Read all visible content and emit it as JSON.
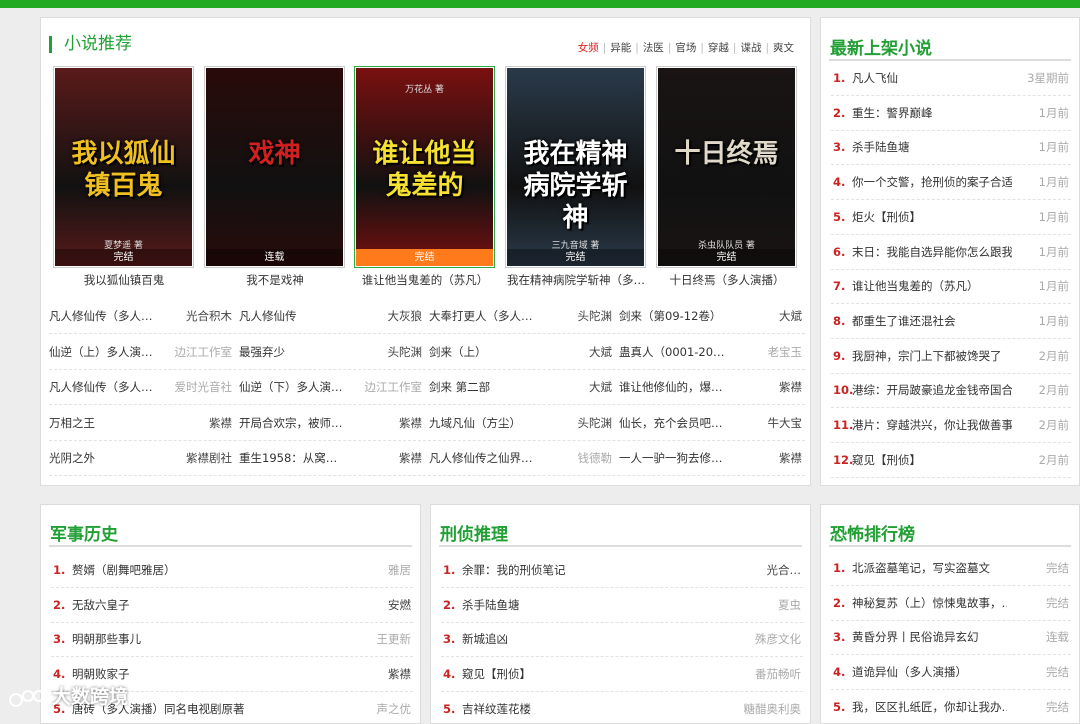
{
  "recommend": {
    "title": "小说推荐",
    "tags": [
      "女频",
      "异能",
      "法医",
      "官场",
      "穿越",
      "谍战",
      "爽文"
    ],
    "active_tag": "女频",
    "covers": [
      {
        "caption": "我以狐仙镇百鬼",
        "cover_text": "我以狐仙镇百鬼",
        "author_line": "夏梦遥 著",
        "status": "完结",
        "bg": "#5a1a1a",
        "accent": "#f0c020"
      },
      {
        "caption": "我不是戏神",
        "cover_text": "戏神",
        "author_line": "",
        "status": "连载",
        "bg": "#2a0a0a",
        "accent": "#d22020"
      },
      {
        "caption": "谁让他当鬼差的（苏凡）",
        "cover_text": "谁让他当鬼差的",
        "author_line": "万花丛 著",
        "status": "完结",
        "bg": "#7a1010",
        "accent": "#f6e030"
      },
      {
        "caption": "我在精神病院学斩神（多…",
        "cover_text": "我在精神病院学斩神",
        "author_line": "三九音域 著",
        "status": "完结",
        "bg": "#2a3a4a",
        "accent": "#ffffff"
      },
      {
        "caption": "十日终焉（多人演播）",
        "cover_text": "十日终焉",
        "author_line": "杀虫队队员 著",
        "status": "完结",
        "bg": "#1a1414",
        "accent": "#e0d8c8"
      }
    ],
    "grid": [
      [
        {
          "title": "凡人修仙传（多人…",
          "author": "光合积木",
          "grey": false
        },
        {
          "title": "凡人修仙传",
          "author": "大灰狼",
          "grey": false
        },
        {
          "title": "大奉打更人（多人…",
          "author": "头陀渊",
          "grey": false
        },
        {
          "title": "剑来（第09-12卷）",
          "author": "大斌",
          "grey": false
        }
      ],
      [
        {
          "title": "仙逆（上）多人演…",
          "author": "边江工作室",
          "grey": true
        },
        {
          "title": "最强弃少",
          "author": "头陀渊",
          "grey": false
        },
        {
          "title": "剑来（上）",
          "author": "大斌",
          "grey": false
        },
        {
          "title": "蛊真人（0001-20…",
          "author": "老宝玉",
          "grey": true
        }
      ],
      [
        {
          "title": "凡人修仙传（多人…",
          "author": "爱时光音社",
          "grey": true
        },
        {
          "title": "仙逆（下）多人演…",
          "author": "边江工作室",
          "grey": true
        },
        {
          "title": "剑来 第二部",
          "author": "大斌",
          "grey": false
        },
        {
          "title": "谁让他修仙的，爆…",
          "author": "紫襟",
          "grey": false
        }
      ],
      [
        {
          "title": "万相之王",
          "author": "紫襟",
          "grey": false
        },
        {
          "title": "开局合欢宗，被师…",
          "author": "紫襟",
          "grey": false
        },
        {
          "title": "九域凡仙（方尘）",
          "author": "头陀渊",
          "grey": false
        },
        {
          "title": "仙长，充个会员吧…",
          "author": "牛大宝",
          "grey": false
        }
      ],
      [
        {
          "title": "光阴之外",
          "author": "紫襟剧社",
          "grey": false
        },
        {
          "title": "重生1958：从窝…",
          "author": "紫襟",
          "grey": false
        },
        {
          "title": "凡人修仙传之仙界…",
          "author": "钱德勒",
          "grey": true
        },
        {
          "title": "一人一驴一狗去修…",
          "author": "紫襟",
          "grey": false
        }
      ]
    ]
  },
  "latest": {
    "title": "最新上架小说",
    "items": [
      {
        "title": "凡人飞仙",
        "time": "3星期前"
      },
      {
        "title": "重生：警界巅峰",
        "time": "1月前"
      },
      {
        "title": "杀手陆鱼塘",
        "time": "1月前"
      },
      {
        "title": "你一个交警，抢刑侦的案子合适吗",
        "time": "1月前"
      },
      {
        "title": "炬火【刑侦】",
        "time": "1月前"
      },
      {
        "title": "末日：我能自选异能你怎么跟我玩",
        "time": "1月前"
      },
      {
        "title": "谁让他当鬼差的（苏凡）",
        "time": "1月前"
      },
      {
        "title": "都重生了谁还混社会",
        "time": "1月前"
      },
      {
        "title": "我厨神，宗门上下都被馋哭了",
        "time": "2月前"
      },
      {
        "title": "港综：开局跛豪追龙金钱帝国合一",
        "time": "2月前"
      },
      {
        "title": "港片：穿越洪兴，你让我做善事",
        "time": "2月前"
      },
      {
        "title": "窥见【刑侦】",
        "time": "2月前"
      }
    ]
  },
  "military": {
    "title": "军事历史",
    "items": [
      {
        "title": "赘婿（剧舞吧雅居）",
        "author": "雅居",
        "dark": false
      },
      {
        "title": "无敌六皇子",
        "author": "安燃",
        "dark": true
      },
      {
        "title": "明朝那些事儿",
        "author": "王更新",
        "dark": false
      },
      {
        "title": "明朝败家子",
        "author": "紫襟",
        "dark": true
      },
      {
        "title": "唐砖（多人演播）同名电视剧原著",
        "author": "声之优",
        "dark": false
      }
    ]
  },
  "detective": {
    "title": "刑侦推理",
    "items": [
      {
        "title": "余罪：我的刑侦笔记",
        "author": "光合…",
        "dark": true
      },
      {
        "title": "杀手陆鱼塘",
        "author": "夏虫",
        "dark": false
      },
      {
        "title": "新城追凶",
        "author": "殊彦文化",
        "dark": false
      },
      {
        "title": "窥见【刑侦】",
        "author": "番茄畅听",
        "dark": false
      },
      {
        "title": "吉祥纹莲花楼",
        "author": "糖醋奥利奥",
        "dark": false
      }
    ]
  },
  "horror": {
    "title": "恐怖排行榜",
    "items": [
      {
        "title": "北派盗墓笔记，写实盗墓文",
        "status": "完结"
      },
      {
        "title": "神秘复苏（上）惊悚鬼故事，…",
        "status": "完结"
      },
      {
        "title": "黄昏分界丨民俗诡异玄幻",
        "status": "连载"
      },
      {
        "title": "道诡异仙（多人演播）",
        "status": "完结"
      },
      {
        "title": "我，区区扎纸匠，你却让我办…",
        "status": "完结"
      }
    ]
  },
  "watermark": {
    "text": "大数跨境"
  },
  "colors": {
    "accent": "#22a035",
    "topbar": "#22aa22",
    "rank": "#cc2222",
    "active_tag": "#e02020",
    "status_orange": "#ff7a1a"
  }
}
